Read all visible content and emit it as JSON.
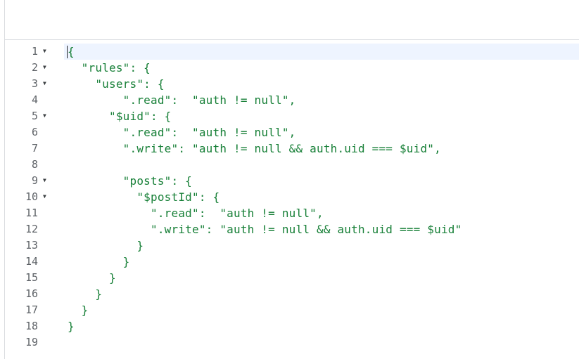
{
  "editor": {
    "active_line": 1,
    "lines": [
      {
        "number": "1",
        "text": "{",
        "fold": "▼"
      },
      {
        "number": "2",
        "text": "  \"rules\": {",
        "fold": "▼"
      },
      {
        "number": "3",
        "text": "    \"users\": {",
        "fold": "▼"
      },
      {
        "number": "4",
        "text": "        \".read\":  \"auth != null\",",
        "fold": ""
      },
      {
        "number": "5",
        "text": "      \"$uid\": {",
        "fold": "▼"
      },
      {
        "number": "6",
        "text": "        \".read\":  \"auth != null\",",
        "fold": ""
      },
      {
        "number": "7",
        "text": "        \".write\": \"auth != null && auth.uid === $uid\",",
        "fold": ""
      },
      {
        "number": "8",
        "text": "",
        "fold": ""
      },
      {
        "number": "9",
        "text": "        \"posts\": {",
        "fold": "▼"
      },
      {
        "number": "10",
        "text": "          \"$postId\": {",
        "fold": "▼"
      },
      {
        "number": "11",
        "text": "            \".read\":  \"auth != null\",",
        "fold": ""
      },
      {
        "number": "12",
        "text": "            \".write\": \"auth != null && auth.uid === $uid\"",
        "fold": ""
      },
      {
        "number": "13",
        "text": "          }",
        "fold": ""
      },
      {
        "number": "14",
        "text": "        }",
        "fold": ""
      },
      {
        "number": "15",
        "text": "      }",
        "fold": ""
      },
      {
        "number": "16",
        "text": "    }",
        "fold": ""
      },
      {
        "number": "17",
        "text": "  }",
        "fold": ""
      },
      {
        "number": "18",
        "text": "}",
        "fold": ""
      },
      {
        "number": "19",
        "text": "",
        "fold": ""
      }
    ]
  },
  "colors": {
    "code_text": "#188038",
    "line_number": "#5f6368",
    "active_line_bg": "#eef4ff",
    "border": "#dadce0"
  }
}
